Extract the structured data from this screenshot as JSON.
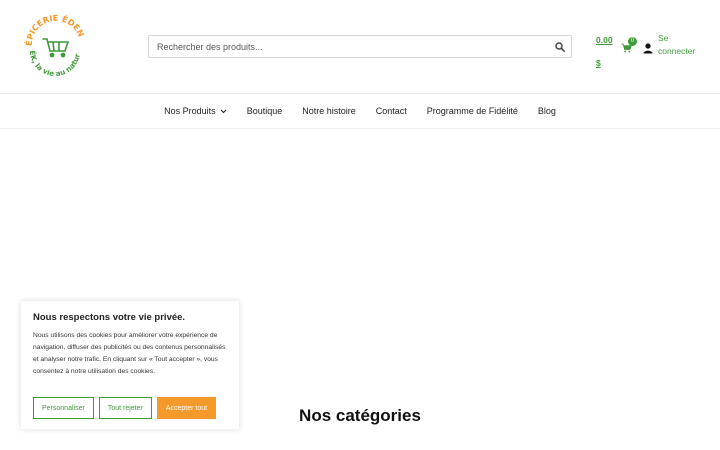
{
  "header": {
    "logo": {
      "text_top": "ÉPICERIE ÉDEN KA",
      "text_bottom": "ÉK, la vie au naturel",
      "icon": "shopping-cart-logo",
      "colors": {
        "orange": "#f39a2b",
        "green": "#3f9a3a"
      }
    },
    "search": {
      "placeholder": "Rechercher des produits...",
      "icon": "search-icon"
    },
    "cart": {
      "total": "0.00 $",
      "count": "0",
      "icon": "cart-icon"
    },
    "account": {
      "label": "Se connecter",
      "icon": "user-icon"
    }
  },
  "nav": {
    "items": [
      {
        "label": "Nos Produits",
        "has_dropdown": true
      },
      {
        "label": "Boutique"
      },
      {
        "label": "Notre histoire"
      },
      {
        "label": "Contact"
      },
      {
        "label": "Programme de Fidélité"
      },
      {
        "label": "Blog"
      }
    ]
  },
  "main": {
    "section_title": "Nos catégories"
  },
  "cookie_banner": {
    "title": "Nous respectons votre vie privée.",
    "body": "Nous utilisons des cookies pour améliorer votre expérience de navigation, diffuser des publicités ou des contenus personnalisés et analyser notre trafic. En cliquant sur « Tout accepter », vous consentez à notre utilisation des cookies.",
    "buttons": {
      "customize": "Personnaliser",
      "reject": "Tout rejeter",
      "accept": "Accepter tout"
    }
  },
  "colors": {
    "accent_green": "#3f9a3a",
    "accent_orange": "#f39a2b"
  }
}
